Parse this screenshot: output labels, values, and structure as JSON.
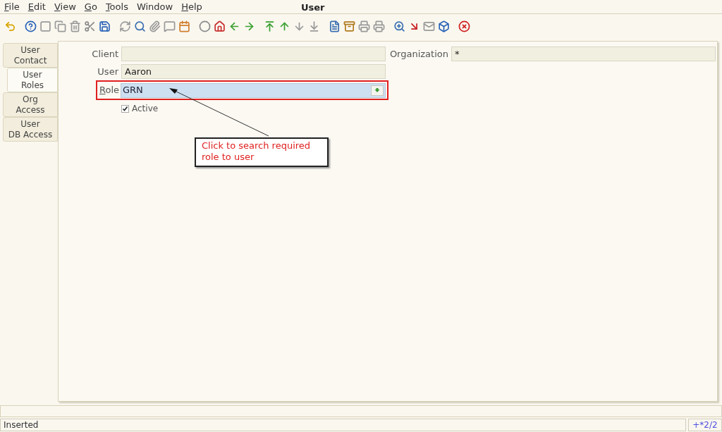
{
  "window": {
    "title": "User"
  },
  "menu": [
    {
      "mnemonic": "F",
      "rest": "ile"
    },
    {
      "mnemonic": "E",
      "rest": "dit"
    },
    {
      "mnemonic": "V",
      "rest": "iew"
    },
    {
      "mnemonic": "G",
      "rest": "o"
    },
    {
      "mnemonic": "T",
      "rest": "ools"
    },
    {
      "rest": "Window"
    },
    {
      "mnemonic": "H",
      "rest": "elp"
    }
  ],
  "tabs": [
    {
      "lines": [
        "User",
        "Contact"
      ],
      "selected": false
    },
    {
      "lines": [
        "User",
        "Roles"
      ],
      "selected": true
    },
    {
      "lines": [
        "Org",
        "Access"
      ],
      "selected": false
    },
    {
      "lines": [
        "User",
        "DB Access"
      ],
      "selected": false
    }
  ],
  "form": {
    "client": {
      "label": "Client"
    },
    "organization": {
      "label": "Organization",
      "value": "*"
    },
    "user": {
      "label": "User",
      "value": "Aaron"
    },
    "role": {
      "mnemonic": "R",
      "rest": "ole",
      "value": "GRN",
      "highlighted": true
    },
    "active": {
      "label": "Active",
      "checked": true
    }
  },
  "annotation": {
    "text": "Click to search required role to user"
  },
  "status_bar": {
    "message": "Inserted",
    "record": "+*2/2"
  }
}
